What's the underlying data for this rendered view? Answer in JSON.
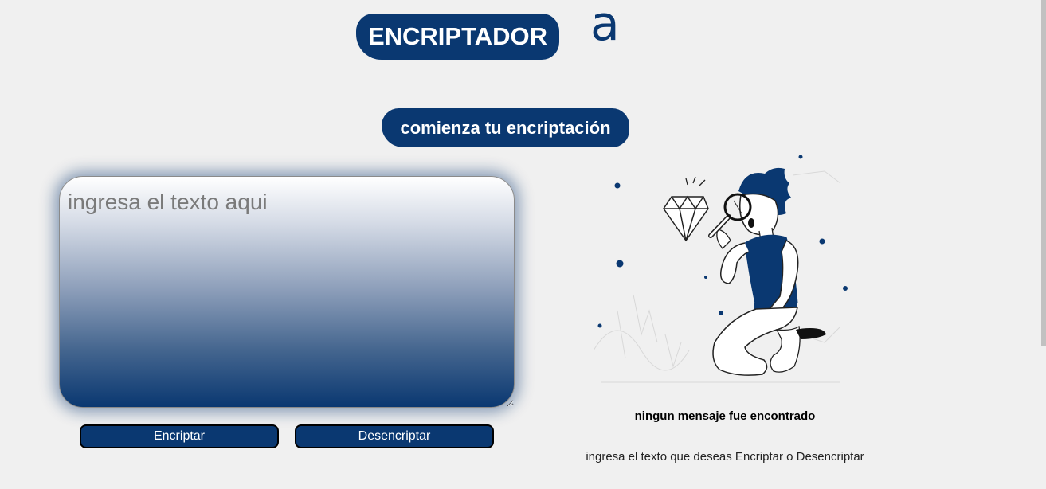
{
  "header": {
    "title": "ENCRIPTADOR",
    "logo_glyph": "a"
  },
  "subtitle": "comienza tu encriptación",
  "input": {
    "placeholder": "ingresa el texto aqui",
    "value": ""
  },
  "buttons": {
    "encrypt_label": "Encriptar",
    "decrypt_label": "Desencriptar"
  },
  "output": {
    "title": "ningun mensaje fue encontrado",
    "body": "ingresa el texto que deseas Encriptar o Desencriptar",
    "illustration": "person-searching-with-magnifier-illustration"
  },
  "colors": {
    "accent": "#0a3871",
    "background": "#f0f0f0"
  }
}
